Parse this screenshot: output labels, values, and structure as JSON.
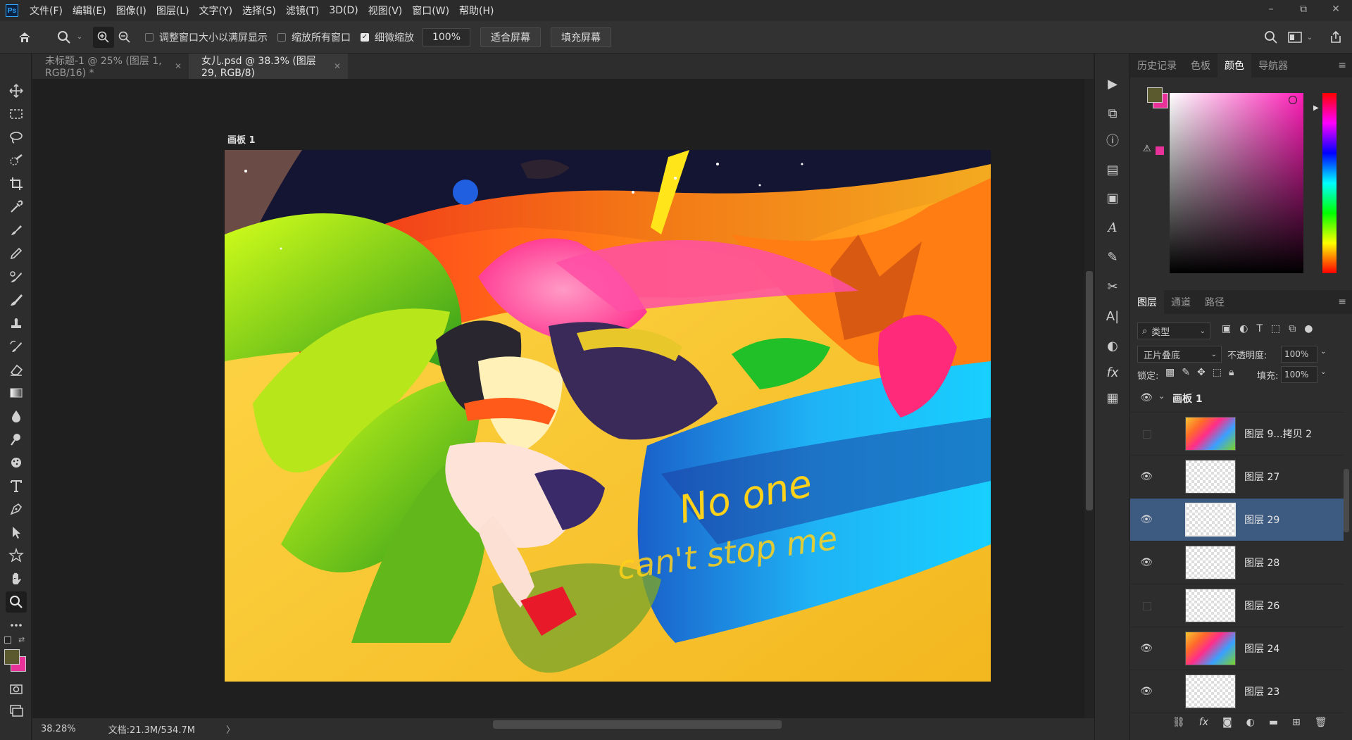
{
  "app": {
    "logo": "Ps"
  },
  "menu": [
    "文件(F)",
    "编辑(E)",
    "图像(I)",
    "图层(L)",
    "文字(Y)",
    "选择(S)",
    "滤镜(T)",
    "3D(D)",
    "视图(V)",
    "窗口(W)",
    "帮助(H)"
  ],
  "window_controls": {
    "minimize": "–",
    "restore": "⧉",
    "close": "✕"
  },
  "options": {
    "fit_window_label": "调整窗口大小以满屏显示",
    "fit_window_checked": false,
    "zoom_all_label": "缩放所有窗口",
    "zoom_all_checked": false,
    "scrubby_label": "细微缩放",
    "scrubby_checked": true,
    "zoom_value": "100%",
    "fit_screen_button": "适合屏幕",
    "fill_screen_button": "填充屏幕"
  },
  "tabs": [
    {
      "label": "未标题-1 @ 25% (图层 1, RGB/16) *",
      "active": false
    },
    {
      "label": "女儿.psd @ 38.3% (图层 29, RGB/8)",
      "active": true
    }
  ],
  "canvas": {
    "artboard_label": "画板 1"
  },
  "status": {
    "zoom": "38.28%",
    "doc_size": "文档:21.3M/534.7M",
    "arrow": "〉"
  },
  "panels": {
    "color_tabs": [
      "历史记录",
      "色板",
      "颜色",
      "导航器"
    ],
    "color_active": "颜色",
    "foreground_color": "#5b5a2f",
    "background_color": "#e8329a",
    "layer_tabs": [
      "图层",
      "通道",
      "路径"
    ],
    "layer_active": "图层",
    "filter_label": "类型",
    "blend_mode": "正片叠底",
    "opacity_label": "不透明度:",
    "opacity_value": "100%",
    "lock_label": "锁定:",
    "fill_label": "填充:",
    "fill_value": "100%",
    "group_name": "画板 1",
    "layers": [
      {
        "name": "图层 9...拷贝 2",
        "visible": false,
        "thumb": "art",
        "selected": false
      },
      {
        "name": "图层 27",
        "visible": true,
        "thumb": "transparent",
        "selected": false
      },
      {
        "name": "图层 29",
        "visible": true,
        "thumb": "transparent",
        "selected": true
      },
      {
        "name": "图层 28",
        "visible": true,
        "thumb": "transparent",
        "selected": false
      },
      {
        "name": "图层 26",
        "visible": false,
        "thumb": "transparent",
        "selected": false
      },
      {
        "name": "图层 24",
        "visible": true,
        "thumb": "art",
        "selected": false
      },
      {
        "name": "图层 23",
        "visible": true,
        "thumb": "transparent",
        "selected": false
      }
    ]
  }
}
